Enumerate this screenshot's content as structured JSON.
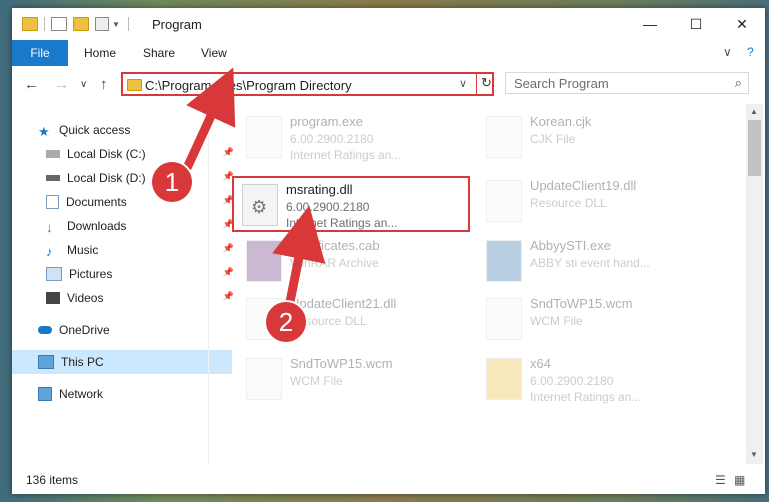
{
  "window": {
    "title": "Program"
  },
  "ribbon": {
    "file": "File",
    "home": "Home",
    "share": "Share",
    "view": "View",
    "chevron": "∨",
    "help": "?"
  },
  "nav": {
    "back": "←",
    "forward": "→",
    "recent": "∨",
    "up": "↑"
  },
  "address": {
    "path": "C:\\Program Files\\Program Directory",
    "dropdown": "∨",
    "refresh": "↻"
  },
  "search": {
    "placeholder": "Search Program",
    "icon": "⌕"
  },
  "sidebar": {
    "items": [
      {
        "label": "Quick access",
        "icon": "star-icon"
      },
      {
        "label": "Local Disk (C:)",
        "icon": "drive-icon"
      },
      {
        "label": "Local Disk (D:)",
        "icon": "drive-icon"
      },
      {
        "label": "Documents",
        "icon": "documents-icon"
      },
      {
        "label": "Downloads",
        "icon": "downloads-icon"
      },
      {
        "label": "Music",
        "icon": "music-icon"
      },
      {
        "label": "Pictures",
        "icon": "pictures-icon"
      },
      {
        "label": "Videos",
        "icon": "videos-icon"
      },
      {
        "label": "OneDrive",
        "icon": "cloud-icon"
      },
      {
        "label": "This PC",
        "icon": "pc-icon"
      },
      {
        "label": "Network",
        "icon": "network-icon"
      }
    ]
  },
  "files": [
    {
      "name": "program.exe",
      "line1": "6.00.2900.2180",
      "line2": "Internet Ratings an..."
    },
    {
      "name": "Korean.cjk",
      "line1": "CJK File",
      "line2": ""
    },
    {
      "name": "msrating.dll",
      "line1": "6.00.2900.2180",
      "line2": "Internet Ratings an..."
    },
    {
      "name": "UpdateClient19.dll",
      "line1": "Resource DLL",
      "line2": ""
    },
    {
      "name": "Certificates.cab",
      "line1": "WinRAR Archive",
      "line2": ""
    },
    {
      "name": "AbbyySTI.exe",
      "line1": "ABBY sti event hand...",
      "line2": ""
    },
    {
      "name": "UpdateClient21.dll",
      "line1": "Resource DLL",
      "line2": ""
    },
    {
      "name": "SndToWP15.wcm",
      "line1": "WCM File",
      "line2": ""
    },
    {
      "name": "SndToWP15.wcm",
      "line1": "WCM File",
      "line2": ""
    },
    {
      "name": "x64",
      "line1": "6.00.2900.2180",
      "line2": "Internet Ratings an..."
    }
  ],
  "status": {
    "items": "136 items"
  },
  "callouts": {
    "one": "1",
    "two": "2"
  },
  "window_controls": {
    "minimize": "—",
    "maximize": "☐",
    "close": "✕"
  },
  "scroll": {
    "up": "▲",
    "down": "▼"
  },
  "pin": "📌",
  "gear": "⚙",
  "colors": {
    "accent": "#1979ca",
    "highlight": "#d9383a",
    "selected": "#cce8ff"
  }
}
